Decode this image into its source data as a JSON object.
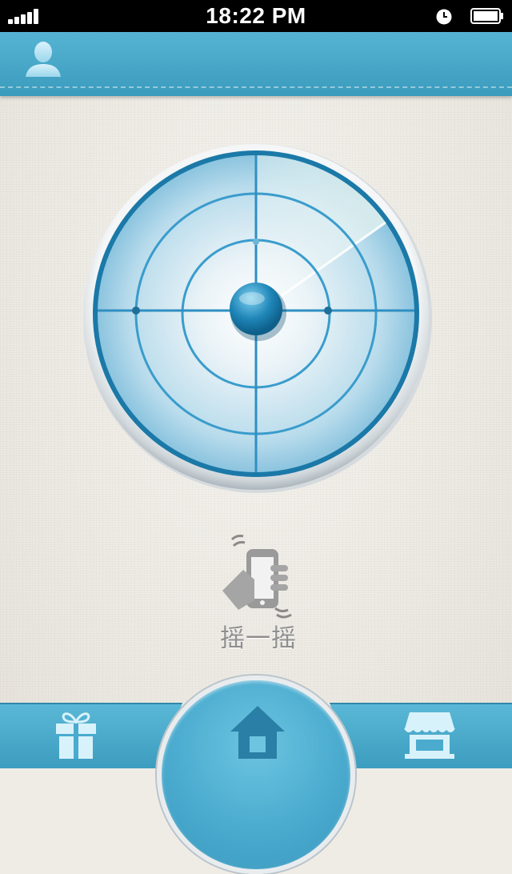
{
  "status_bar": {
    "time": "18:22  PM",
    "signal_icon": "signal-bars-icon",
    "alarm_icon": "alarm-clock-icon",
    "battery_icon": "battery-full-icon"
  },
  "header": {
    "user_icon": "user-profile-icon"
  },
  "radar": {
    "icon": "radar-scope"
  },
  "shake": {
    "icon": "phone-shake-icon",
    "label": "摇一摇"
  },
  "tab_bar": {
    "left_icon": "gift-icon",
    "center_icon": "home-icon",
    "right_icon": "store-icon"
  },
  "colors": {
    "accent": "#3e9fc2",
    "accent_light": "#5ab8d6",
    "background": "#efece6",
    "label": "#8f8f8f"
  }
}
